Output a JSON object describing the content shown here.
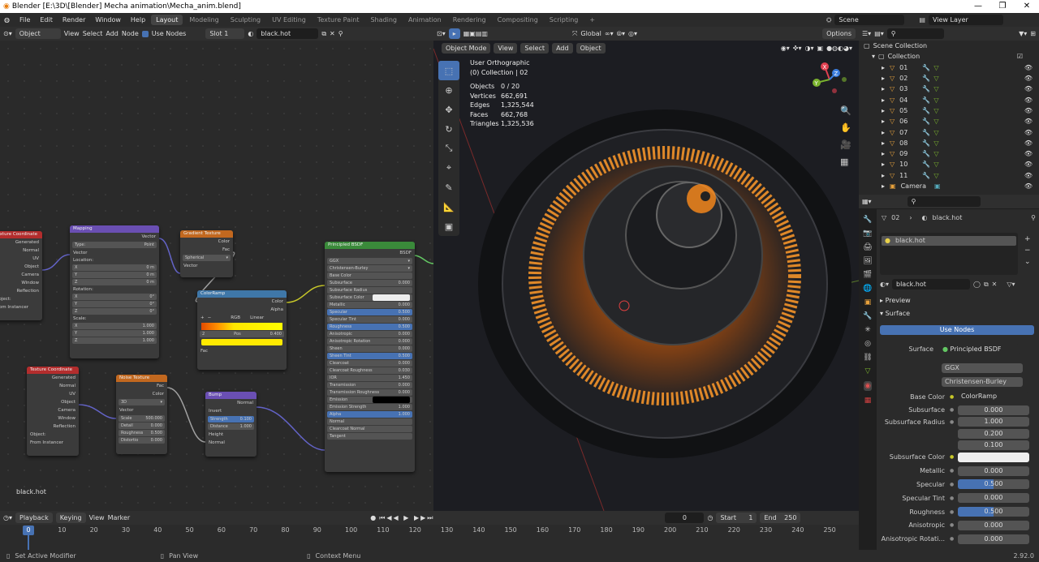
{
  "window": {
    "title": "Blender [E:\\3D\\[Blender] Mecha animation\\Mecha_anim.blend]",
    "min": "—",
    "max": "❐",
    "close": "✕"
  },
  "menu": {
    "items": [
      "File",
      "Edit",
      "Render",
      "Window",
      "Help"
    ],
    "workspaces": [
      "Layout",
      "Modeling",
      "Sculpting",
      "UV Editing",
      "Texture Paint",
      "Shading",
      "Animation",
      "Rendering",
      "Compositing",
      "Scripting"
    ],
    "add_ws": "+",
    "scene": "Scene",
    "view_layer": "View Layer"
  },
  "node_header": {
    "object": "Object",
    "view": "View",
    "select": "Select",
    "add": "Add",
    "node": "Node",
    "use_nodes": "Use Nodes",
    "slot": "Slot 1",
    "material": "black.hot"
  },
  "viewport_header": {
    "orientation": "Global",
    "options": "Options",
    "mode": "Object Mode",
    "view": "View",
    "select": "Select",
    "add": "Add",
    "object": "Object"
  },
  "viewport_info": {
    "line1": "User Orthographic",
    "line2": "(0) Collection | 02",
    "objects_l": "Objects",
    "objects_v": "0 / 20",
    "vertices_l": "Vertices",
    "vertices_v": "662,691",
    "edges_l": "Edges",
    "edges_v": "1,325,544",
    "faces_l": "Faces",
    "faces_v": "662,768",
    "tris_l": "Triangles",
    "tris_v": "1,325,536"
  },
  "gizmo": {
    "x": "X",
    "y": "Y",
    "z": "Z"
  },
  "nodes": {
    "texcoord1": {
      "title": "Texture Coordinate",
      "outs": [
        "Generated",
        "Normal",
        "UV",
        "Object",
        "Camera",
        "Window",
        "Reflection"
      ],
      "object": "Object:",
      "instancer": "From Instancer"
    },
    "mapping": {
      "title": "Mapping",
      "out": "Vector",
      "type_l": "Type:",
      "type_v": "Point",
      "vector": "Vector",
      "location": "Location:",
      "lx": "X",
      "ly": "Y",
      "lz": "Z",
      "lxv": "0 m",
      "lyv": "0 m",
      "lzv": "0 m",
      "rotation": "Rotation:",
      "rxv": "0°",
      "ryv": "0°",
      "rzv": "0°",
      "scale": "Scale:",
      "sxv": "1.000",
      "syv": "1.000",
      "szv": "1.000"
    },
    "gradient": {
      "title": "Gradient Texture",
      "out1": "Color",
      "out2": "Fac",
      "type": "Spherical",
      "in": "Vector"
    },
    "colorramp": {
      "title": "ColorRamp",
      "out1": "Color",
      "out2": "Alpha",
      "mode": "RGB",
      "interp": "Linear",
      "idx": "2",
      "pos_l": "Pos",
      "pos_v": "0.400",
      "in": "Fac"
    },
    "bsdf": {
      "title": "Principled BSDF",
      "out": "BSDF",
      "dist": "GGX",
      "sss": "Christensen-Burley",
      "rows": [
        [
          "Base Color",
          ""
        ],
        [
          "Subsurface",
          "0.000"
        ],
        [
          "Subsurface Radius",
          ""
        ],
        [
          "Subsurface Color",
          ""
        ],
        [
          "Metallic",
          "0.000"
        ],
        [
          "Specular",
          "0.500"
        ],
        [
          "Specular Tint",
          "0.000"
        ],
        [
          "Roughness",
          "0.500"
        ],
        [
          "Anisotropic",
          "0.000"
        ],
        [
          "Anisotropic Rotation",
          "0.000"
        ],
        [
          "Sheen",
          "0.000"
        ],
        [
          "Sheen Tint",
          "0.500"
        ],
        [
          "Clearcoat",
          "0.000"
        ],
        [
          "Clearcoat Roughness",
          "0.030"
        ],
        [
          "IOR",
          "1.450"
        ],
        [
          "Transmission",
          "0.000"
        ],
        [
          "Transmission Roughness",
          "0.000"
        ],
        [
          "Emission",
          ""
        ],
        [
          "Emission Strength",
          "1.000"
        ],
        [
          "Alpha",
          "1.000"
        ],
        [
          "Normal",
          ""
        ],
        [
          "Clearcoat Normal",
          ""
        ],
        [
          "Tangent",
          ""
        ]
      ]
    },
    "texcoord2": {
      "title": "Texture Coordinate",
      "outs": [
        "Generated",
        "Normal",
        "UV",
        "Object",
        "Camera",
        "Window",
        "Reflection"
      ],
      "object": "Object:",
      "instancer": "From Instancer"
    },
    "noise": {
      "title": "Noise Texture",
      "out1": "Fac",
      "out2": "Color",
      "dim": "3D",
      "vector": "Vector",
      "scale_l": "Scale",
      "scale_v": "500.000",
      "detail_l": "Detail",
      "detail_v": "0.000",
      "rough_l": "Roughness",
      "rough_v": "0.500",
      "dist_l": "Distortio",
      "dist_v": "0.000"
    },
    "bump": {
      "title": "Bump",
      "out": "Normal",
      "invert": "Invert",
      "str_l": "Strength",
      "str_v": "0.100",
      "dist_l": "Distance",
      "dist_v": "1.000",
      "height": "Height",
      "normal": "Normal"
    }
  },
  "node_footer": "black.hot",
  "outliner": {
    "scene_collection": "Scene Collection",
    "collection": "Collection",
    "items": [
      "01",
      "02",
      "03",
      "04",
      "05",
      "06",
      "07",
      "08",
      "09",
      "10",
      "11"
    ],
    "camera": "Camera"
  },
  "props": {
    "obj": "02",
    "mat": "black.hot",
    "slot": "black.hot",
    "matname": "black.hot",
    "preview": "Preview",
    "surface_panel": "Surface",
    "use_nodes": "Use Nodes",
    "surface_l": "Surface",
    "surface_v": "Principled BSDF",
    "dist": "GGX",
    "sss": "Christensen-Burley",
    "rows": [
      {
        "l": "Base Color",
        "v": "ColorRamp",
        "kind": "link"
      },
      {
        "l": "Subsurface",
        "v": "0.000"
      },
      {
        "l": "Subsurface Radius",
        "v": "1.000"
      },
      {
        "l": "",
        "v": "0.200"
      },
      {
        "l": "",
        "v": "0.100"
      },
      {
        "l": "Subsurface Color",
        "v": "",
        "kind": "color"
      },
      {
        "l": "Metallic",
        "v": "0.000"
      },
      {
        "l": "Specular",
        "v": "0.500",
        "kind": "bar"
      },
      {
        "l": "Specular Tint",
        "v": "0.000"
      },
      {
        "l": "Roughness",
        "v": "0.500",
        "kind": "bar"
      },
      {
        "l": "Anisotropic",
        "v": "0.000"
      },
      {
        "l": "Anisotropic Rotati...",
        "v": "0.000"
      }
    ]
  },
  "timeline": {
    "playback": "Playback",
    "keying": "Keying",
    "view": "View",
    "marker": "Marker",
    "frame": "0",
    "start_l": "Start",
    "start_v": "1",
    "end_l": "End",
    "end_v": "250",
    "current": "0",
    "ticks": [
      "0",
      "10",
      "20",
      "30",
      "40",
      "50",
      "60",
      "70",
      "80",
      "90",
      "100",
      "110",
      "120",
      "130",
      "140",
      "150",
      "160",
      "170",
      "180",
      "190",
      "200",
      "210",
      "220",
      "230",
      "240",
      "250"
    ]
  },
  "status": {
    "left": "Set Active Modifier",
    "mid": "Pan View",
    "right": "Context Menu",
    "version": "2.92.0"
  },
  "colors": {
    "accent": "#4772b3",
    "orange": "#ff8c1a",
    "bsdf_header": "#3a8a3a",
    "mapping_header": "#6a4fb3",
    "texture_header": "#c2681f",
    "colorramp_header": "#3f77a8",
    "texcoord_header": "#b32d2d"
  }
}
